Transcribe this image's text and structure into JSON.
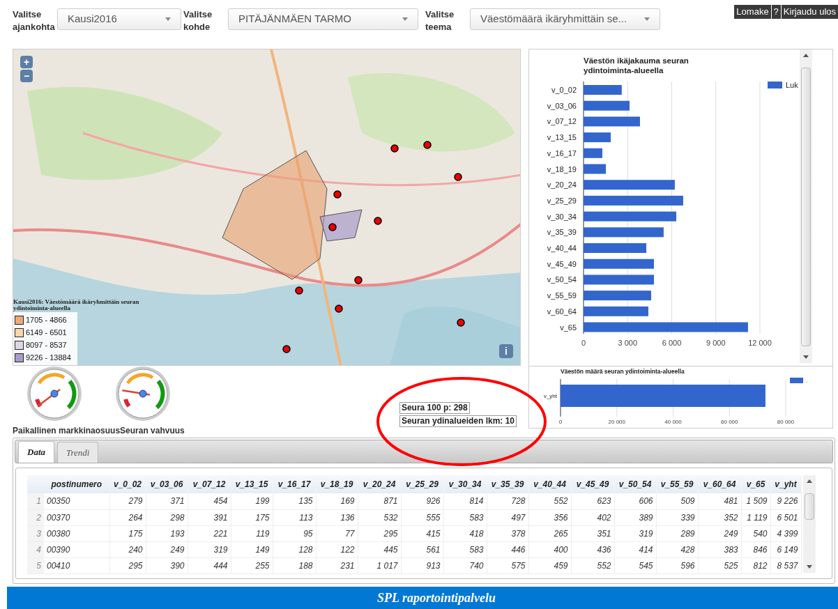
{
  "filters": [
    {
      "label": "Valitse ajankohta",
      "value": "Kausi2016"
    },
    {
      "label": "Valitse kohde",
      "value": "PITÄJÄNMÄEN TARMO"
    },
    {
      "label": "Valitse teema",
      "value": "Väestömäärä ikäryhmittäin se..."
    }
  ],
  "header_buttons": [
    "Lomake",
    "?",
    "Kirjaudu ulos"
  ],
  "map": {
    "zoom_in": "+",
    "zoom_out": "−",
    "info": "i",
    "legend": {
      "title": "Kausi2016: Väestömäärä ikäryhmittäin seuran ydintoiminta-alueella",
      "items": [
        {
          "label": "1705 - 4866",
          "color": "#eda97a"
        },
        {
          "label": "6149 - 6501",
          "color": "#fbd7a8"
        },
        {
          "label": "8097 - 8537",
          "color": "#dcd8e6"
        },
        {
          "label": "9226 - 13884",
          "color": "#a99bc9"
        }
      ]
    }
  },
  "gauges": [
    {
      "label": "Paikallinen markkinaosuus"
    },
    {
      "label": "Seuran vahvuus"
    }
  ],
  "stats": [
    "Seura 100 p: 298",
    "Seuran ydinalueiden lkm: 10"
  ],
  "age_chart": {
    "chart_data": {
      "type": "bar",
      "orientation": "horizontal",
      "title": "Väestön ikäjakauma seuran ydintoiminta-alueella",
      "categories": [
        "v_0_02",
        "v_03_06",
        "v_07_12",
        "v_13_15",
        "v_16_17",
        "v_18_19",
        "v_20_24",
        "v_25_29",
        "v_30_34",
        "v_35_39",
        "v_40_44",
        "v_45_49",
        "v_50_54",
        "v_55_59",
        "v_60_64",
        "v_65"
      ],
      "series": [
        {
          "name": "Luk",
          "color": "#3366cc",
          "values": [
            2600,
            3130,
            3840,
            1850,
            1280,
            1520,
            6210,
            6780,
            6310,
            5450,
            4270,
            4790,
            4790,
            4600,
            4410,
            11190
          ]
        }
      ],
      "xlim": [
        0,
        12000
      ],
      "grid": true,
      "xticks": [
        {
          "value": 0,
          "label": "0"
        },
        {
          "value": 3000,
          "label": "3 000"
        },
        {
          "value": 6000,
          "label": "6 000"
        },
        {
          "value": 9000,
          "label": "9 000"
        },
        {
          "value": 12000,
          "label": "12 000"
        }
      ]
    }
  },
  "total_chart": {
    "chart_data": {
      "type": "bar",
      "orientation": "horizontal",
      "title": "Väestön määrä seuran ydintoiminta-alueella",
      "categories": [
        "v_yht"
      ],
      "series": [
        {
          "name": ".",
          "color": "#3366cc",
          "values": [
            72800
          ]
        }
      ],
      "xlim": [
        0,
        80000
      ],
      "grid": true,
      "xticks": [
        {
          "value": 0,
          "label": "0"
        },
        {
          "value": 20000,
          "label": "20 000"
        },
        {
          "value": 40000,
          "label": "40 000"
        },
        {
          "value": 60000,
          "label": "60 000"
        },
        {
          "value": 80000,
          "label": "80 000"
        }
      ]
    }
  },
  "tabs": [
    {
      "label": "Data",
      "selected": true
    },
    {
      "label": "Trendi",
      "selected": false
    }
  ],
  "table": {
    "columns": [
      "postinumero",
      "v_0_02",
      "v_03_06",
      "v_07_12",
      "v_13_15",
      "v_16_17",
      "v_18_19",
      "v_20_24",
      "v_25_29",
      "v_30_34",
      "v_35_39",
      "v_40_44",
      "v_45_49",
      "v_50_54",
      "v_55_59",
      "v_60_64",
      "v_65",
      "v_yht"
    ],
    "rows": [
      {
        "number": "1",
        "cells": [
          "00350",
          "279",
          "371",
          "454",
          "199",
          "135",
          "169",
          "871",
          "926",
          "814",
          "728",
          "552",
          "623",
          "606",
          "509",
          "481",
          "1 509",
          "9 226"
        ]
      },
      {
        "number": "2",
        "cells": [
          "00370",
          "264",
          "298",
          "391",
          "175",
          "113",
          "136",
          "532",
          "555",
          "583",
          "497",
          "356",
          "402",
          "389",
          "339",
          "352",
          "1 119",
          "6 501"
        ]
      },
      {
        "number": "3",
        "cells": [
          "00380",
          "175",
          "193",
          "221",
          "119",
          "95",
          "77",
          "295",
          "415",
          "418",
          "378",
          "265",
          "351",
          "319",
          "289",
          "249",
          "540",
          "4 399"
        ]
      },
      {
        "number": "4",
        "cells": [
          "00390",
          "240",
          "249",
          "319",
          "149",
          "128",
          "122",
          "445",
          "561",
          "583",
          "446",
          "400",
          "436",
          "414",
          "428",
          "383",
          "846",
          "6 149"
        ]
      },
      {
        "number": "5",
        "cells": [
          "00410",
          "295",
          "390",
          "444",
          "255",
          "188",
          "231",
          "1 017",
          "913",
          "740",
          "575",
          "459",
          "552",
          "545",
          "596",
          "525",
          "812",
          "8 537"
        ]
      }
    ]
  },
  "footer": "SPL raportointipalvelu"
}
